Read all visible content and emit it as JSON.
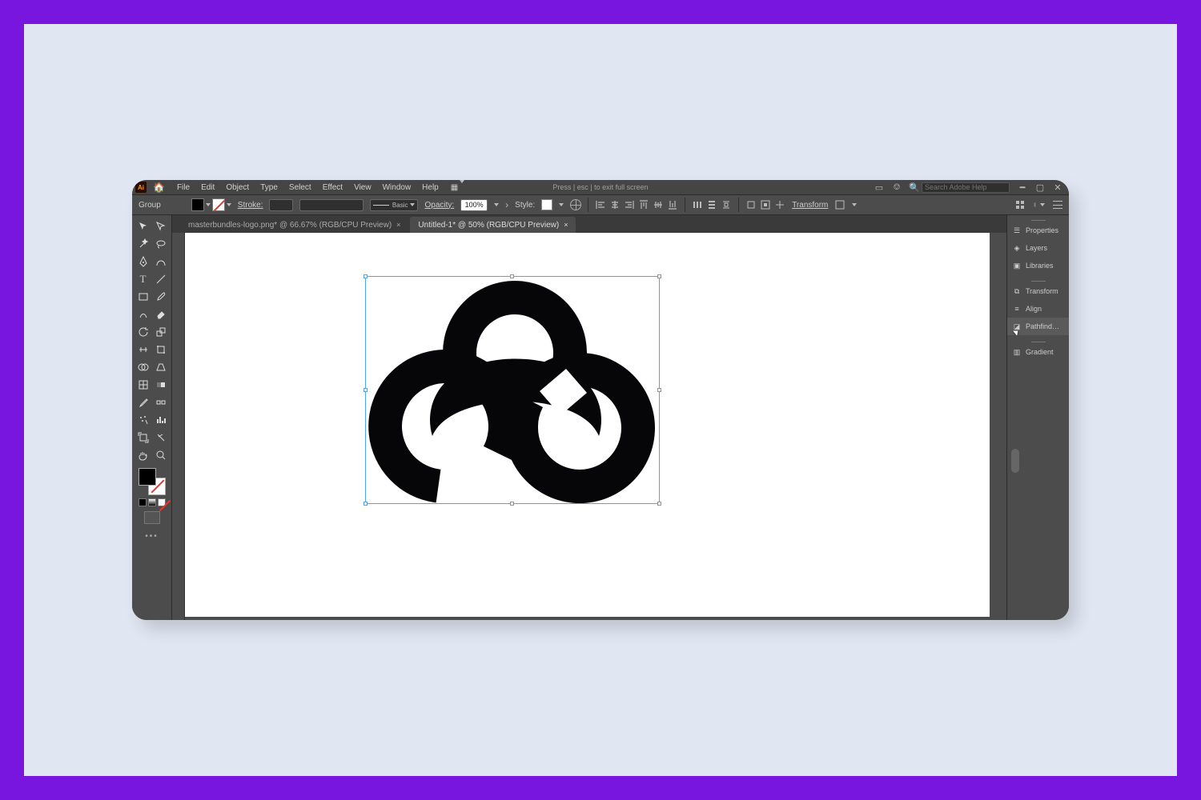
{
  "menubar": {
    "items": [
      "File",
      "Edit",
      "Object",
      "Type",
      "Select",
      "Effect",
      "View",
      "Window",
      "Help"
    ],
    "fullscreen_hint": "Press | esc | to exit full screen",
    "search_placeholder": "Search Adobe Help"
  },
  "controlbar": {
    "selection_label": "Group",
    "stroke_label": "Stroke:",
    "stroke_style_label": "Basic",
    "opacity_label": "Opacity:",
    "opacity_value": "100%",
    "style_label": "Style:",
    "transform_label": "Transform"
  },
  "doctabs": [
    {
      "label": "masterbundles-logo.png* @ 66.67% (RGB/CPU Preview)",
      "active": false
    },
    {
      "label": "Untitled-1* @ 50% (RGB/CPU Preview)",
      "active": true
    }
  ],
  "right_panels": {
    "group1": [
      "Properties",
      "Layers",
      "Libraries"
    ],
    "group2": [
      "Transform",
      "Align",
      "Pathfind…"
    ],
    "group3": [
      "Gradient"
    ],
    "selected": "Pathfind…"
  },
  "colors": {
    "purple_frame": "#7816e0",
    "page_bg": "#e0e7f3",
    "ui_dark": "#4c4c4c"
  }
}
